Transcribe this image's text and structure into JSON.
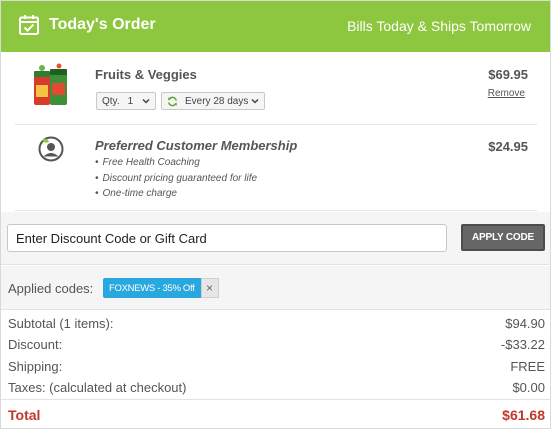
{
  "header": {
    "title": "Today's Order",
    "billing_note": "Bills Today & Ships Tomorrow",
    "icon": "calendar-check-icon",
    "bg_color": "#8dc63f"
  },
  "items": [
    {
      "name": "Fruits & Veggies",
      "price": "$69.95",
      "qty_label": "Qty.",
      "qty_value": "1",
      "frequency": "Every 28 days",
      "remove_label": "Remove",
      "icon": "supplement-bottles-thumbnail"
    },
    {
      "name": "Preferred Customer Membership",
      "price": "$24.95",
      "icon": "member-avatar-icon",
      "benefits": [
        "Free Health Coaching",
        "Discount pricing guaranteed for life",
        "One-time charge"
      ]
    }
  ],
  "discount": {
    "placeholder": "Enter Discount Code or Gift Card",
    "apply_label": "APPLY CODE"
  },
  "applied": {
    "label": "Applied codes:",
    "codes": [
      {
        "text": "FOXNEWS - 35% Off",
        "remove": "×"
      }
    ],
    "chip_color": "#29a8e0"
  },
  "summary": {
    "subtotal_label": "Subtotal (1 items):",
    "subtotal_value": "$94.90",
    "discount_label": "Discount:",
    "discount_value": "-$33.22",
    "shipping_label": "Shipping:",
    "shipping_value": "FREE",
    "taxes_label": "Taxes: (calculated at checkout)",
    "taxes_value": "$0.00",
    "total_label": "Total",
    "total_value": "$61.68",
    "total_color": "#c0392b"
  }
}
